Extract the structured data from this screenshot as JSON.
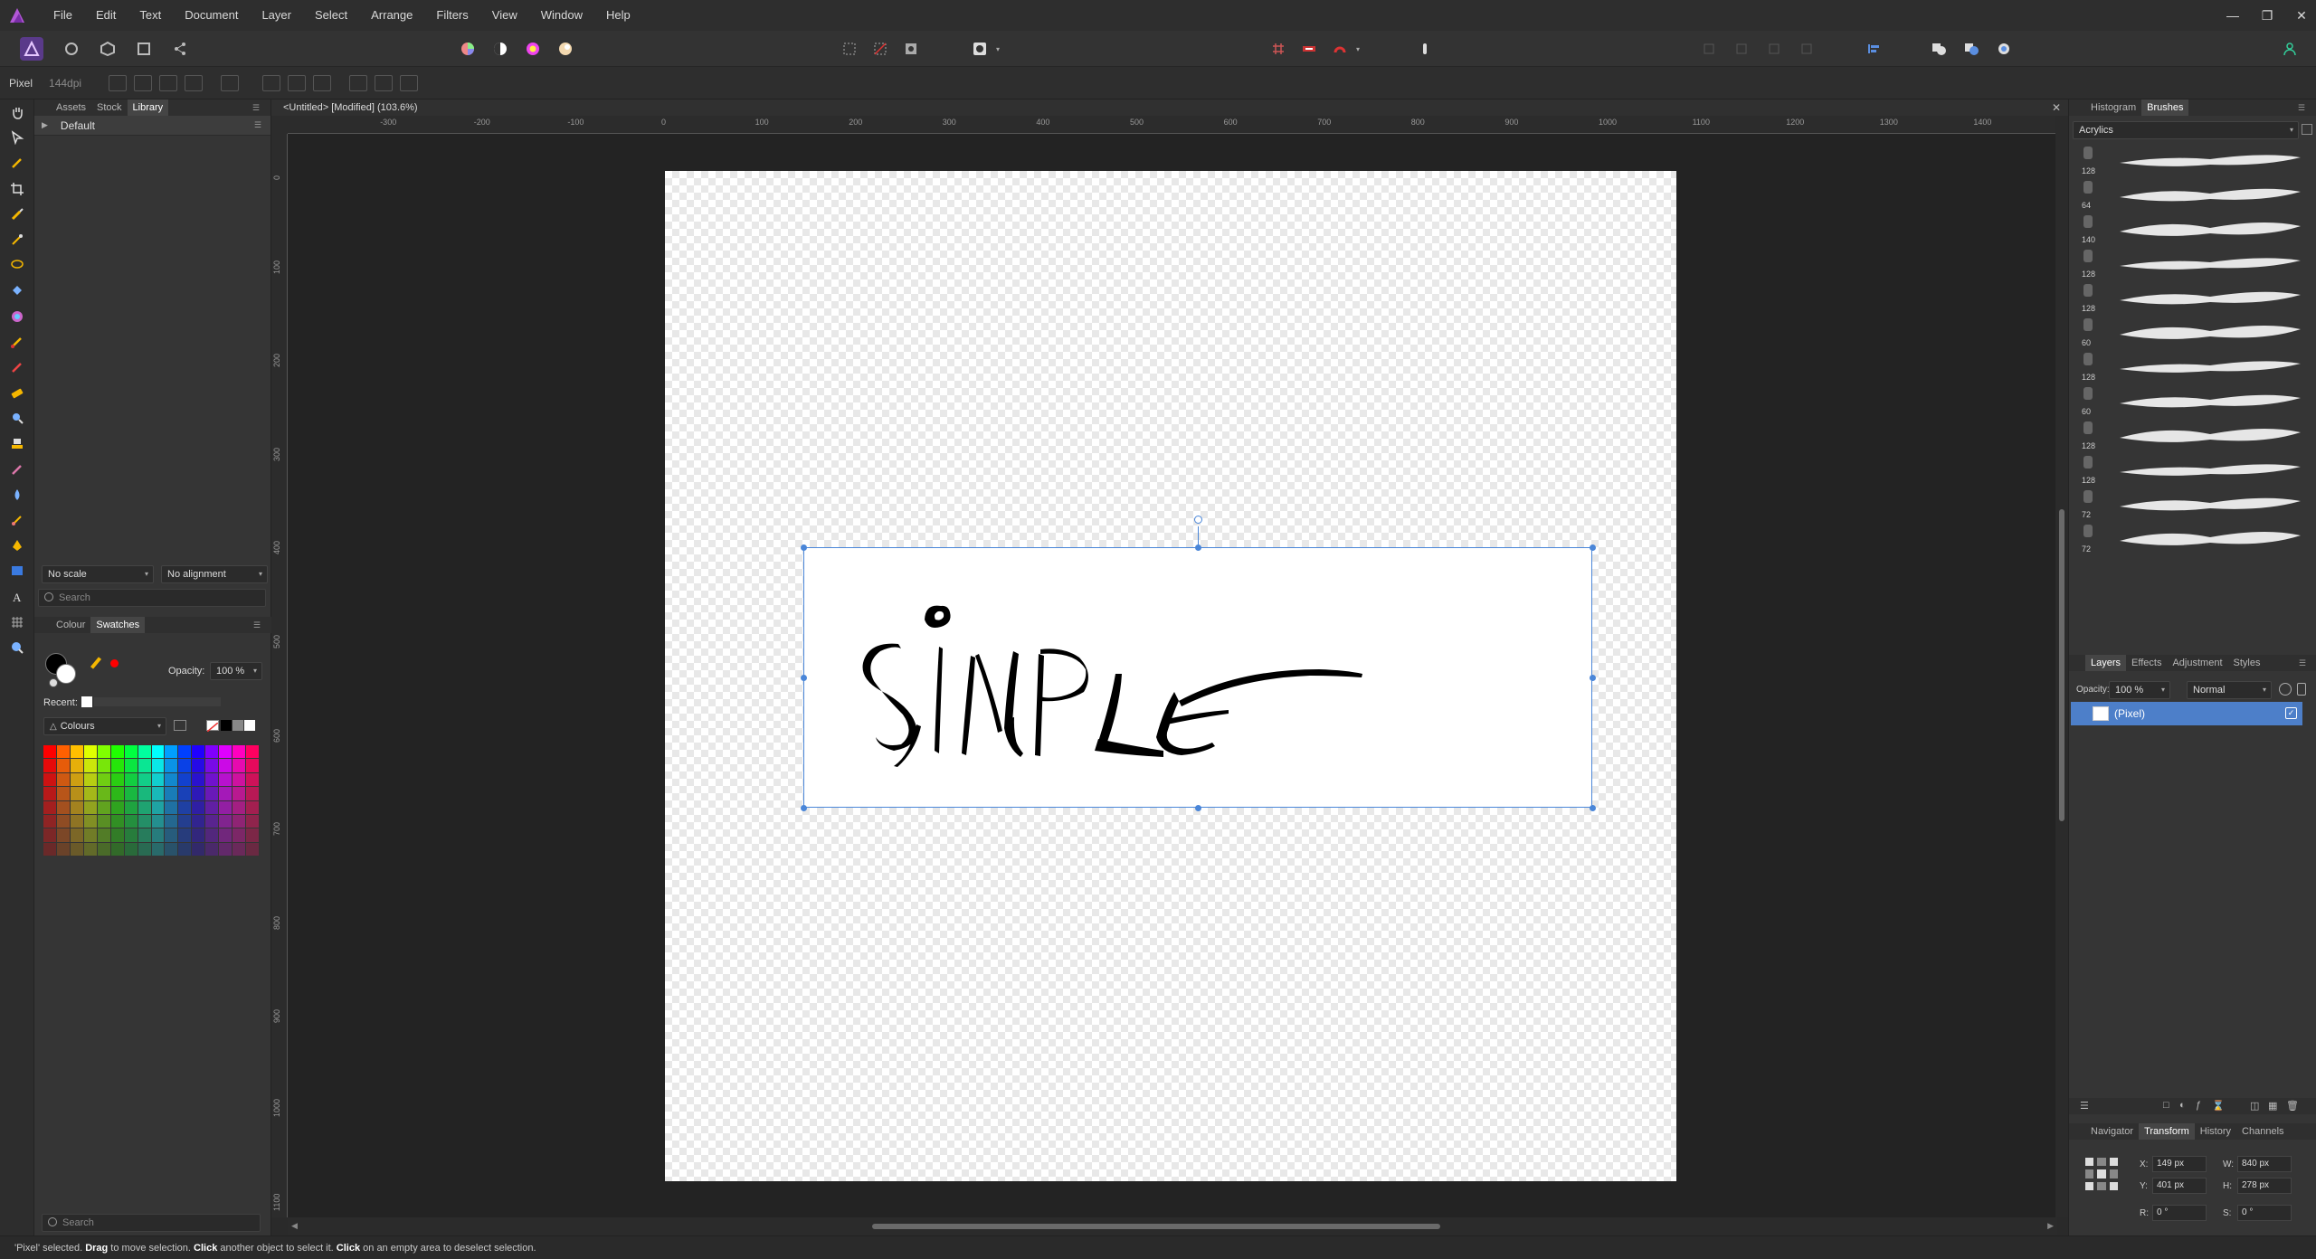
{
  "menu": {
    "items": [
      "File",
      "Edit",
      "Text",
      "Document",
      "Layer",
      "Select",
      "Arrange",
      "Filters",
      "View",
      "Window",
      "Help"
    ]
  },
  "context": {
    "persona_label": "Pixel",
    "dpi": "144dpi"
  },
  "left": {
    "tabs": [
      "Assets",
      "Stock",
      "Library"
    ],
    "active_tab": "Library",
    "library_group": "Default",
    "scale_option": "No scale",
    "alignment_option": "No alignment",
    "search_placeholder": "Search",
    "colour_tabs": [
      "Colour",
      "Swatches"
    ],
    "opacity_label": "Opacity:",
    "opacity_value": "100 %",
    "recent_label": "Recent:",
    "palette_name": "Colours",
    "bottom_search_placeholder": "Search"
  },
  "document": {
    "title": "<Untitled> [Modified] (103.6%)",
    "ruler_h": [
      "-300",
      "-200",
      "-100",
      "0",
      "100",
      "200",
      "300",
      "400",
      "500",
      "600",
      "700",
      "800",
      "900",
      "1000",
      "1100",
      "1200",
      "1300",
      "1400"
    ],
    "ruler_v": [
      "0",
      "100",
      "200",
      "300",
      "400",
      "500",
      "600",
      "700",
      "800",
      "900",
      "1000",
      "1100"
    ]
  },
  "right": {
    "top_tabs": [
      "Histogram",
      "Brushes"
    ],
    "active_top_tab": "Brushes",
    "brush_category": "Acrylics",
    "brush_sizes": [
      "128",
      "64",
      "140",
      "128",
      "128",
      "60",
      "128",
      "60",
      "128",
      "128",
      "72",
      "72"
    ],
    "layer_tabs": [
      "Layers",
      "Effects",
      "Adjustment",
      "Styles"
    ],
    "layer_opacity_label": "Opacity:",
    "layer_opacity": "100 %",
    "blend_mode": "Normal",
    "layer_name": "(Pixel)",
    "bottom_tabs": [
      "Navigator",
      "Transform",
      "History",
      "Channels"
    ],
    "active_bottom_tab": "Transform",
    "transform": {
      "x_label": "X:",
      "x": "149 px",
      "y_label": "Y:",
      "y": "401 px",
      "w_label": "W:",
      "w": "840 px",
      "h_label": "H:",
      "h": "278 px",
      "r_label": "R:",
      "r": "0 °",
      "s_label": "S:",
      "s": "0 °"
    }
  },
  "status": {
    "prefix": "'Pixel' selected. ",
    "drag": "Drag",
    "drag_text": " to move selection. ",
    "click1": "Click",
    "click1_text": " another object to select it. ",
    "click2": "Click",
    "click2_text": " on an empty area to deselect selection."
  },
  "colors": {
    "accent": "#4a86d8",
    "primary": "#000000",
    "secondary": "#ffffff",
    "picker_dot": "#ff0000"
  }
}
